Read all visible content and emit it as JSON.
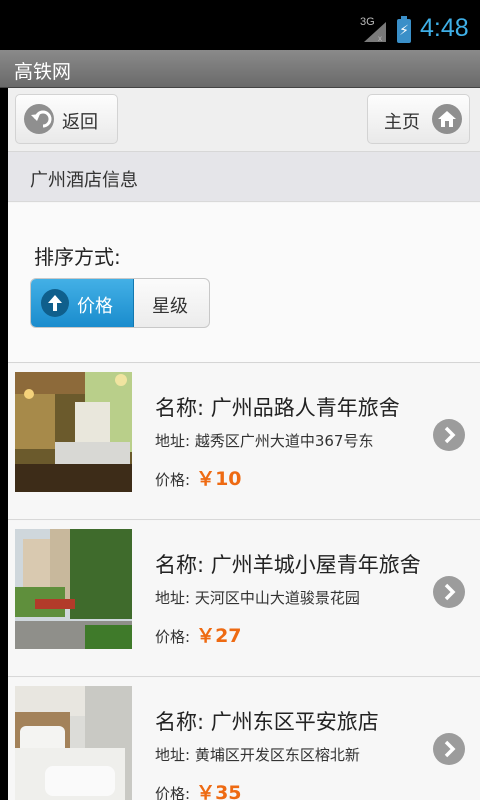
{
  "statusbar": {
    "network": "3G",
    "time": "4:48"
  },
  "appbar": {
    "title": "高铁网"
  },
  "header": {
    "back_label": "返回",
    "home_label": "主页"
  },
  "section": {
    "title": "广州酒店信息"
  },
  "sort": {
    "label": "排序方式:",
    "options": [
      "价格",
      "星级"
    ],
    "selected": "价格"
  },
  "hotels": [
    {
      "name": "名称: 广州品路人青年旅舍",
      "address": "地址: 越秀区广州大道中367号东",
      "price_label": "价格:",
      "price": "￥10"
    },
    {
      "name": "名称: 广州羊城小屋青年旅舍",
      "address": "地址: 天河区中山大道骏景花园",
      "price_label": "价格:",
      "price": "￥27"
    },
    {
      "name": "名称: 广州东区平安旅店",
      "address": "地址: 黄埔区开发区东区榕北新",
      "price_label": "价格:",
      "price": "￥35"
    }
  ],
  "colors": {
    "accent": "#1a8ccd",
    "price": "#ee6a12",
    "clock": "#3fb0e8"
  },
  "icons": {
    "back": "back-arrow-icon",
    "home": "home-icon",
    "sort": "arrow-up-icon",
    "row": "chevron-right-icon"
  }
}
